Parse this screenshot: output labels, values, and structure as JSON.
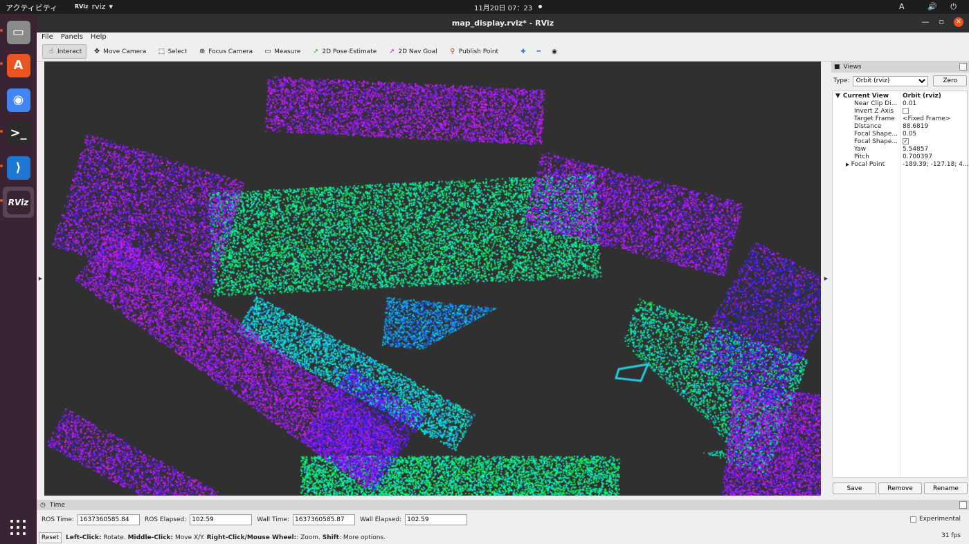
{
  "topbar": {
    "activities": "アクティビティ",
    "app_label": "rviz",
    "clock": "11月20日  07：23",
    "input_method": "A",
    "system_icons": "🔊 ⏻ ▾"
  },
  "dock": {
    "items": [
      {
        "name": "files",
        "glyph": "▭",
        "color": "#8a8a8a"
      },
      {
        "name": "software",
        "glyph": "A",
        "color": "#e95420"
      },
      {
        "name": "chrome",
        "glyph": "◉",
        "color": "#4285f4"
      },
      {
        "name": "terminal",
        "glyph": ">_",
        "color": "#2b2b2b"
      },
      {
        "name": "vscode",
        "glyph": "⟩",
        "color": "#1e78d2"
      },
      {
        "name": "rviz",
        "glyph": "RViz",
        "color": "#3a2433"
      }
    ]
  },
  "window": {
    "title": "map_display.rviz* - RViz",
    "controls": {
      "minimize": "—",
      "maximize": "▫",
      "close": "✕"
    }
  },
  "menu": {
    "file": "File",
    "panels": "Panels",
    "help": "Help"
  },
  "toolbar": [
    {
      "label": "Interact",
      "glyph": "☝",
      "active": true
    },
    {
      "label": "Move Camera",
      "glyph": "✥",
      "active": false
    },
    {
      "label": "Select",
      "glyph": "⬚",
      "active": false
    },
    {
      "label": "Focus Camera",
      "glyph": "⊕",
      "active": false
    },
    {
      "label": "Measure",
      "glyph": "▭",
      "active": false
    },
    {
      "label": "2D Pose Estimate",
      "glyph": "➚",
      "active": false
    },
    {
      "label": "2D Nav Goal",
      "glyph": "➚",
      "active": false
    },
    {
      "label": "Publish Point",
      "glyph": "⚲",
      "active": false
    }
  ],
  "toolbar_extra": {
    "add": "✚",
    "remove": "━",
    "eye": "◉"
  },
  "views": {
    "title": "Views",
    "type_label": "Type:",
    "type_value": "Orbit (rviz)",
    "zero": "Zero",
    "header_key": "Current View",
    "header_value": "Orbit (rviz)",
    "props": [
      {
        "k": "Near Clip Di...",
        "v": "0.01",
        "chk": null
      },
      {
        "k": "Invert Z Axis",
        "v": "",
        "chk": false
      },
      {
        "k": "Target Frame",
        "v": "<Fixed Frame>",
        "chk": null
      },
      {
        "k": "Distance",
        "v": "88.6819",
        "chk": null
      },
      {
        "k": "Focal Shape...",
        "v": "0.05",
        "chk": null
      },
      {
        "k": "Focal Shape...",
        "v": "",
        "chk": true
      },
      {
        "k": "Yaw",
        "v": "5.54857",
        "chk": null
      },
      {
        "k": "Pitch",
        "v": "0.700397",
        "chk": null
      },
      {
        "k": "Focal Point",
        "v": "-189.39; -127.18; 4...",
        "chk": null
      }
    ],
    "buttons": {
      "save": "Save",
      "remove": "Remove",
      "rename": "Rename"
    }
  },
  "time": {
    "title": "Time",
    "ros_time_label": "ROS Time:",
    "ros_time": "1637360585.84",
    "ros_elapsed_label": "ROS Elapsed:",
    "ros_elapsed": "102.59",
    "wall_time_label": "Wall Time:",
    "wall_time": "1637360585.87",
    "wall_elapsed_label": "Wall Elapsed:",
    "wall_elapsed": "102.59",
    "experimental": "Experimental"
  },
  "status": {
    "reset": "Reset",
    "help_b1": "Left-Click:",
    "help_t1": " Rotate. ",
    "help_b2": "Middle-Click:",
    "help_t2": " Move X/Y. ",
    "help_b3": "Right-Click/Mouse Wheel:",
    "help_t3": ": Zoom. ",
    "help_b4": "Shift",
    "help_t4": ": More options.",
    "fps": "31 fps"
  },
  "colors": {
    "accent": "#e95420",
    "viewport_bg": "#303030",
    "cloud_high": "#d01cf0",
    "cloud_low": "#20e060"
  }
}
